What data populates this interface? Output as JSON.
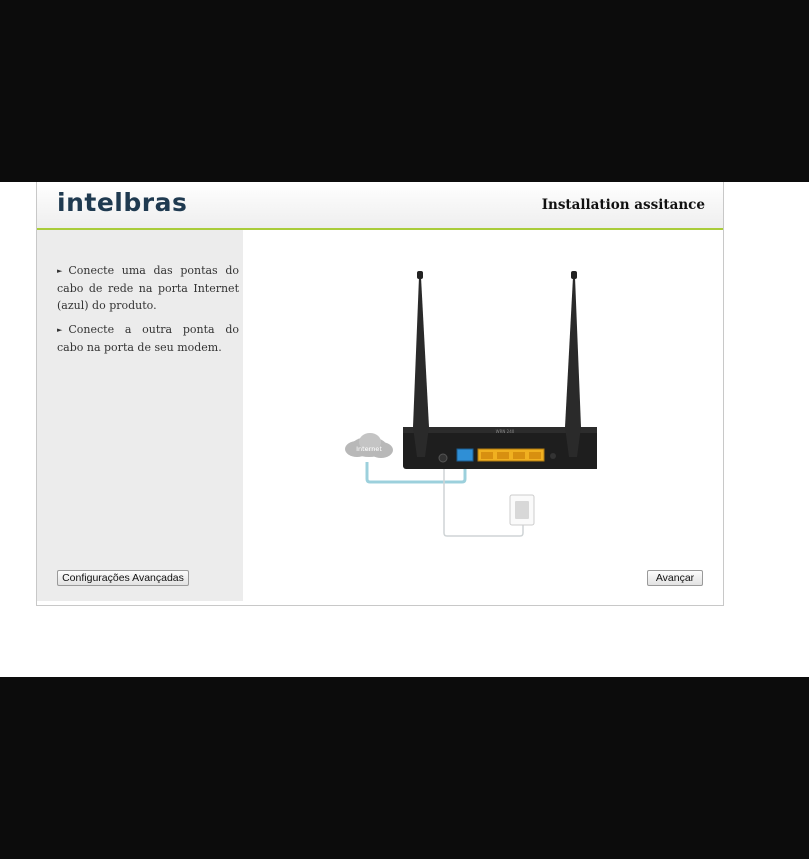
{
  "header": {
    "logo_text": "intelbras",
    "title": "Installation assitance"
  },
  "instructions": [
    "Conecte uma das pontas do cabo de rede na porta Internet (azul) do produto.",
    "Conecte a outra ponta do cabo na porta de seu modem."
  ],
  "diagram": {
    "cloud_label": "Internet",
    "device_label": "WRN 240",
    "colors": {
      "wan_port": "#2f8fd6",
      "lan_ports": "#f0b020",
      "cable": "#9cd0dc",
      "router": "#1e1e1e"
    },
    "icons": [
      "router-image",
      "cloud-icon",
      "power-adapter-icon"
    ]
  },
  "buttons": {
    "advanced": "Configurações Avançadas",
    "next": "Avançar"
  },
  "colors": {
    "accent_line": "#a9cc3a",
    "sidebar_bg": "#ececec",
    "logo": "#1f3a50"
  }
}
